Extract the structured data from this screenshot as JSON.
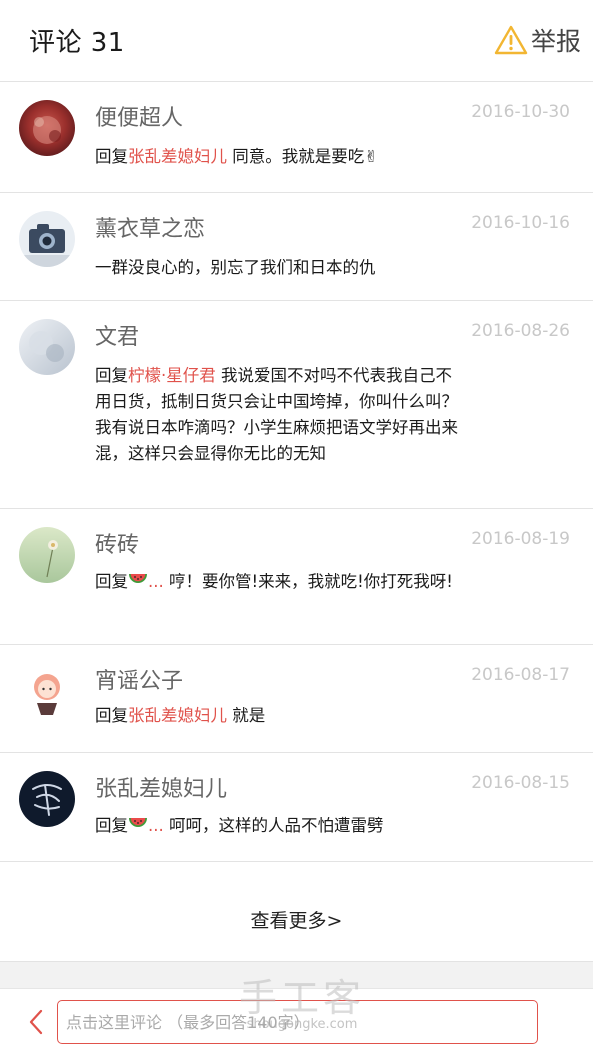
{
  "header": {
    "title": "评论 31",
    "report_label": "举报",
    "report_icon": "warning-triangle-icon",
    "accent": "#f2b632"
  },
  "comments": [
    {
      "user": "便便超人",
      "date": "2016-10-30",
      "prefix": "回复",
      "mention": "张乱差媳妇儿",
      "text": " 同意。我就是要吃✌"
    },
    {
      "user": "薰衣草之恋",
      "date": "2016-10-16",
      "prefix": "",
      "mention": "",
      "text": "一群没良心的，别忘了我们和日本的仇"
    },
    {
      "user": "文君",
      "date": "2016-08-26",
      "prefix": "回复",
      "mention": "柠檬·星仔君",
      "text": " 我说爱国不对吗不代表我自己不用日货，抵制日货只会让中国垮掉，你叫什么叫？我有说日本咋滴吗？小学生麻烦把语文学好再出来混，这样只会显得你无比的无知"
    },
    {
      "user": "砖砖",
      "date": "2016-08-19",
      "prefix": "回复",
      "mention_emoji": "watermelon-icon",
      "ellipsis": "...",
      "text": " 哼！要你管!来来，我就吃!你打死我呀!"
    },
    {
      "user": "宵谣公子",
      "date": "2016-08-17",
      "prefix": "回复",
      "mention": "张乱差媳妇儿",
      "text": " 就是"
    },
    {
      "user": "张乱差媳妇儿",
      "date": "2016-08-15",
      "prefix": "回复",
      "mention_emoji": "watermelon-icon",
      "ellipsis": "...",
      "text": " 呵呵，这样的人品不怕遭雷劈"
    }
  ],
  "load_more": "查看更多>",
  "bottom": {
    "placeholder": "点击这里评论 （最多回答140字）",
    "back_icon": "chevron-left-icon"
  },
  "watermark": {
    "cn": "手工客",
    "en": "shougongke.com"
  },
  "colors": {
    "mention": "#e0524b",
    "date": "#c8c8c8",
    "divider": "#e3e3e3"
  }
}
